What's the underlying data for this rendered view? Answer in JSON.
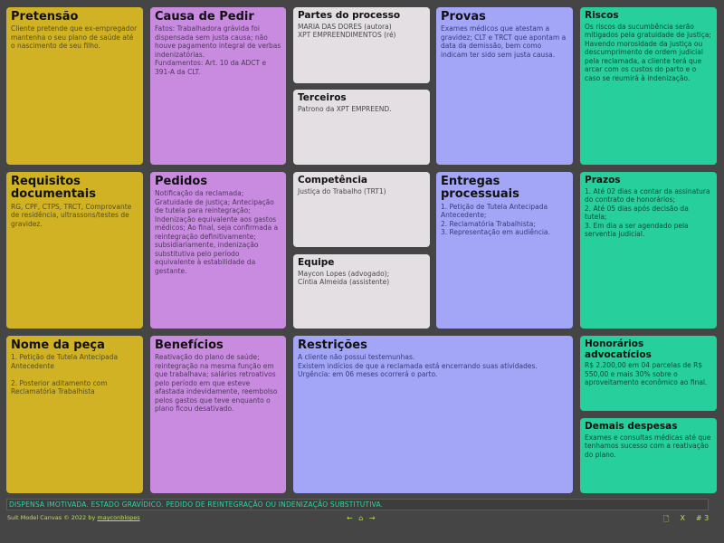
{
  "cards": {
    "pretensao": {
      "title": "Pretensão",
      "text": "Cliente pretende que ex-empregador mantenha o seu plano de saúde até o nascimento de seu filho."
    },
    "requisitos": {
      "title": "Requisitos documentais",
      "text": "RG, CPF, CTPS, TRCT, Comprovante de residência, ultrassons/testes de gravidez."
    },
    "nome_peca": {
      "title": "Nome da peça",
      "text": "1. Petição de Tutela Antecipada Antecedente\n\n2. Posterior aditamento com Reclamatória Trabalhista"
    },
    "causa": {
      "title": "Causa de Pedir",
      "text": "Fatos: Trabalhadora grávida foi dispensada sem justa causa; não houve pagamento integral de verbas indenizatórias.\nFundamentos: Art. 10 da ADCT e 391-A da CLT."
    },
    "pedidos": {
      "title": "Pedidos",
      "text": "Notificação da reclamada;\nGratuidade de justiça; Antecipação de tutela para reintegração;\nIndenização equivalente aos gastos médicos; Ao final, seja confirmada a reintegração definitivamente;\nsubsidiariamente, indenização substitutiva pelo período equivalente à estabilidade da gestante."
    },
    "beneficios": {
      "title": "Benefícios",
      "text": "Reativação do plano de saúde;\nreintegração na mesma função em que trabalhava; salários retroativos pelo período em que esteve afastada indevidamente, reembolso pelos gastos que teve enquanto o plano ficou desativado."
    },
    "partes": {
      "title": "Partes do processo",
      "text": "MARIA DAS DORES (autora)\nXPT EMPREENDIMENTOS (ré)"
    },
    "terceiros": {
      "title": "Terceiros",
      "text": "Patrono da XPT EMPREEND."
    },
    "competencia": {
      "title": "Competência",
      "text": "Justiça do Trabalho (TRT1)"
    },
    "equipe": {
      "title": "Equipe",
      "text": "Maycon Lopes (advogado);\nCíntia Almeida (assistente)"
    },
    "restricoes": {
      "title": "Restrições",
      "text": "A cliente não possui testemunhas.\nExistem indícios de que a reclamada está encerrando suas atividades.\nUrgência: em 06 meses ocorrerá o parto."
    },
    "provas": {
      "title": "Provas",
      "text": "Exames médicos que atestam a gravidez; CLT e TRCT que apontam a data da demissão, bem como indicam ter sido sem justa causa."
    },
    "entregas": {
      "title": "Entregas processuais",
      "text": "1. Petição de Tutela Antecipada Antecedente;\n2. Reclamatória Trabalhista;\n3. Representação em audiência."
    },
    "riscos": {
      "title": "Riscos",
      "text": "Os riscos da sucumbência serão mitigados pela gratuidade de justiça;\nHavendo morosidade da justiça ou descumprimento de ordem judicial pela reclamada, a cliente terá que arcar com os custos do parto e o caso se reumirá à indenização."
    },
    "prazos": {
      "title": "Prazos",
      "text": "1. Até 02 dias a contar da assinatura do contrato de honorários;\n2. Até 05 dias após decisão da tutela;\n3. Em dia a ser agendado pela serventia judicial."
    },
    "honorarios": {
      "title": "Honorários advocatícios",
      "text": "R$ 2.200,00 em 04 parcelas de R$ 550,00 e mais 30% sobre o aproveitamento econômico ao final."
    },
    "despesas": {
      "title": "Demais despesas",
      "text": "Exames e consultas médicas até que tenhamos sucesso com a reativação do plano."
    }
  },
  "footer": {
    "summary": "DISPENSA IMOTIVADA. ESTADO GRAVÍDICO. PEDIDO DE REINTEGRAÇÃO OU INDENIZAÇÃO SUBSTITUTIVA.",
    "credit_prefix": "Suit Model Canvas © 2022 by ",
    "credit_link": "mayconblopes",
    "pager": "← ⌂ →",
    "tool_new": "🗋",
    "tool_clear": "X",
    "tool_grid": "# 3"
  },
  "colors": {
    "background": "#454545",
    "yellow": "#d0b224",
    "purple": "#c98be0",
    "light": "#e3dfe2",
    "blue": "#a3a6f7",
    "green": "#26cf9b",
    "footer_text": "#2fd39f",
    "credit_text": "#b8e04a"
  }
}
